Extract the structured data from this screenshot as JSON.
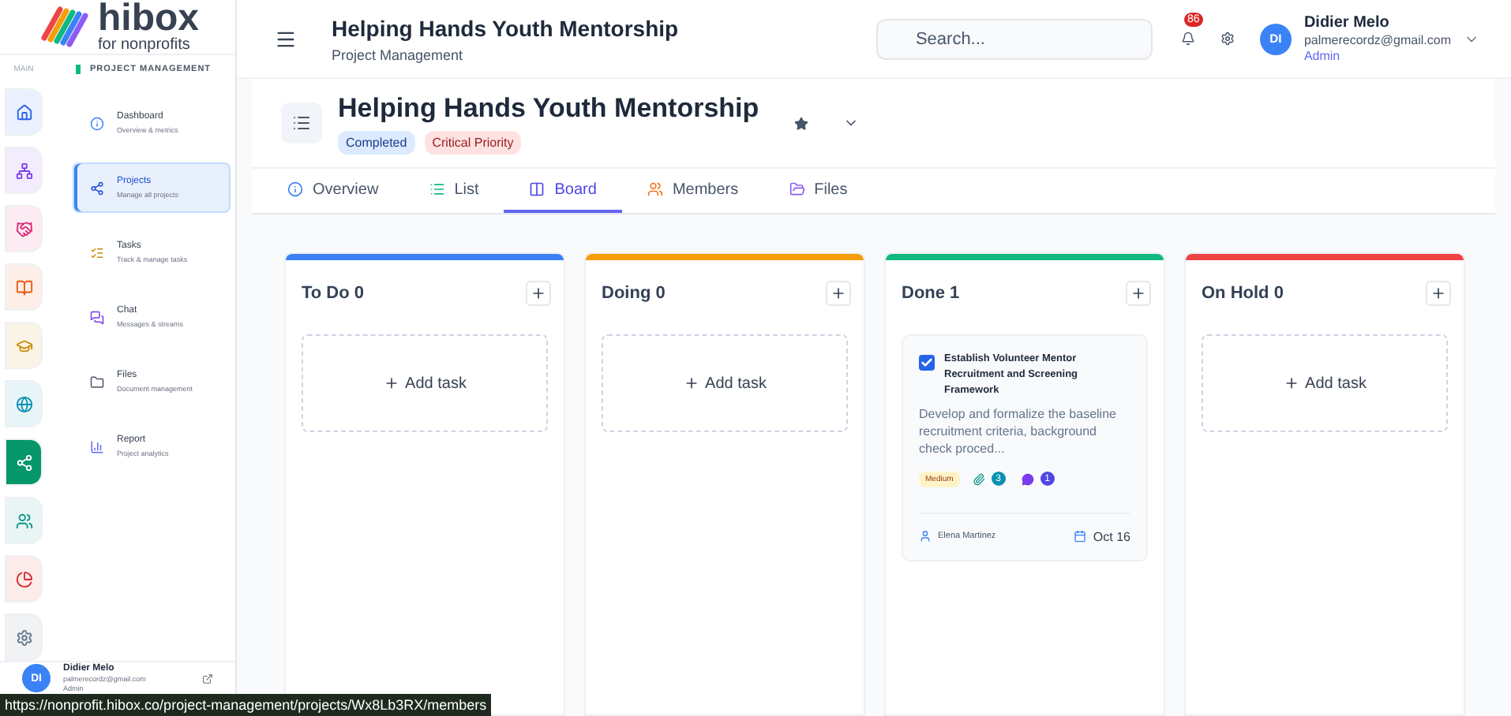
{
  "logo": {
    "name": "hibox",
    "tagline": "for nonprofits"
  },
  "rail": {
    "label": "MAIN",
    "items": [
      {
        "kind": "home",
        "color": "#2563eb",
        "selected": false
      },
      {
        "kind": "sitemap",
        "color": "#7c3aed",
        "selected": false
      },
      {
        "kind": "handshake",
        "color": "#db2777",
        "selected": false
      },
      {
        "kind": "book",
        "color": "#ea580c",
        "selected": false
      },
      {
        "kind": "cap",
        "color": "#ca8a04",
        "selected": false
      },
      {
        "kind": "globe",
        "color": "#0891b2",
        "selected": false
      },
      {
        "kind": "projects",
        "color": "#059669",
        "selected": true
      },
      {
        "kind": "people",
        "color": "#0d9488",
        "selected": false
      },
      {
        "kind": "pie",
        "color": "#dc2626",
        "selected": false
      },
      {
        "kind": "gear",
        "color": "#64748b",
        "selected": false
      }
    ]
  },
  "section": {
    "title": "PROJECT MANAGEMENT"
  },
  "nav": [
    {
      "kind": "dashboard",
      "label": "Dashboard",
      "sub": "Overview & metrics",
      "selected": false
    },
    {
      "kind": "projects",
      "label": "Projects",
      "sub": "Manage all projects",
      "selected": true
    },
    {
      "kind": "tasks",
      "label": "Tasks",
      "sub": "Track & manage tasks",
      "selected": false
    },
    {
      "kind": "chat",
      "label": "Chat",
      "sub": "Messages & streams",
      "selected": false
    },
    {
      "kind": "files",
      "label": "Files",
      "sub": "Document management",
      "selected": false
    },
    {
      "kind": "report",
      "label": "Report",
      "sub": "Project analytics",
      "selected": false
    }
  ],
  "sidebar_user": {
    "initials": "DI",
    "name": "Didier Melo",
    "email": "palmerecordz@gmail.com",
    "role": "Admin"
  },
  "header": {
    "title": "Helping Hands Youth Mentorship",
    "subtitle": "Project Management",
    "search": {
      "placeholder": "Search..."
    },
    "notifications": "86",
    "user": {
      "initials": "DI",
      "name": "Didier Melo",
      "email": "palmerecordz@gmail.com",
      "role": "Admin"
    }
  },
  "project": {
    "title": "Helping Hands Youth Mentorship",
    "badges": [
      {
        "label": "Completed",
        "kind": "status"
      },
      {
        "label": "Critical Priority",
        "kind": "priority"
      }
    ]
  },
  "tabs": [
    {
      "kind": "overview",
      "label": "Overview",
      "selected": false
    },
    {
      "kind": "list",
      "label": "List",
      "selected": false
    },
    {
      "kind": "board",
      "label": "Board",
      "selected": true
    },
    {
      "kind": "members",
      "label": "Members",
      "selected": false
    },
    {
      "kind": "files",
      "label": "Files",
      "selected": false
    }
  ],
  "columns": [
    {
      "title": "To Do 0",
      "color": "#3b82f6",
      "add_label": "Add task"
    },
    {
      "title": "Doing 0",
      "color": "#f59e0b",
      "add_label": "Add task"
    },
    {
      "title": "Done 1",
      "color": "#10b981",
      "tasks": [
        {
          "title": "Establish Volunteer Mentor Recruitment and Screening Framework",
          "checked": true,
          "description": "Develop and formalize the baseline recruitment criteria, background check proced...",
          "priority": "Medium",
          "attachments": "3",
          "comments": "1",
          "assignee": "Elena Martinez",
          "due": "Oct 16"
        }
      ]
    },
    {
      "title": "On Hold 0",
      "color": "#ef4444",
      "add_label": "Add task"
    }
  ],
  "status_url": "https://nonprofit.hibox.co/project-management/projects/Wx8Lb3RX/members"
}
